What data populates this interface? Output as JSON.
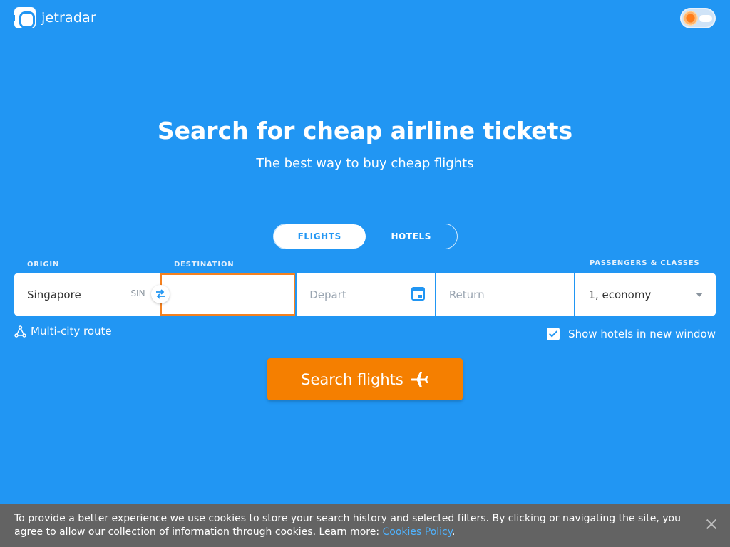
{
  "brand": {
    "name": "jetradar"
  },
  "hero": {
    "title": "Search for cheap airline tickets",
    "subtitle": "The best way to buy cheap flights"
  },
  "tabs": [
    {
      "label": "FLIGHTS",
      "active": true
    },
    {
      "label": "HOTELS",
      "active": false
    }
  ],
  "form": {
    "origin": {
      "label": "ORIGIN",
      "value": "Singapore",
      "code": "SIN"
    },
    "destination": {
      "label": "DESTINATION",
      "value": ""
    },
    "depart": {
      "placeholder": "Depart"
    },
    "return": {
      "placeholder": "Return"
    },
    "passengers": {
      "label": "PASSENGERS & CLASSES",
      "value": "1, economy"
    }
  },
  "multi_city": {
    "label": "Multi-city route"
  },
  "hotels_option": {
    "label": "Show hotels in new window",
    "checked": true
  },
  "search_button": {
    "label": "Search flights"
  },
  "cookie_bar": {
    "text": "To provide a better experience we use cookies to store your search history and selected filters. By clicking or navigating the site, you agree to allow our collection of information through cookies. Learn more: ",
    "link_text": "Cookies Policy",
    "suffix": "."
  },
  "colors": {
    "background": "#2196f3",
    "accent": "#f57f00",
    "focus_border": "#f5811f",
    "cookie_bg": "#636363",
    "link": "#4fb3ff"
  },
  "icons": [
    "logo-icon",
    "theme-toggle-icon",
    "swap-icon",
    "calendar-icon",
    "chevron-down-icon",
    "route-icon",
    "checkbox-icon",
    "airplane-icon",
    "close-icon"
  ]
}
